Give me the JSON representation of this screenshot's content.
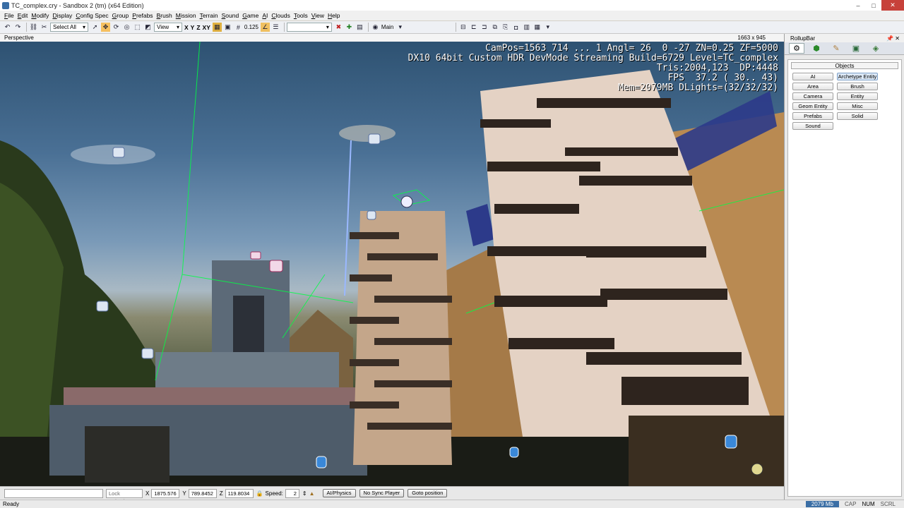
{
  "window": {
    "title": "TC_complex.cry - Sandbox 2 (tm) (x64 Edition)",
    "controls": [
      "–",
      "□",
      "✕"
    ]
  },
  "menu": [
    "File",
    "Edit",
    "Modify",
    "Display",
    "Config Spec",
    "Group",
    "Prefabs",
    "Brush",
    "Mission",
    "Terrain",
    "Sound",
    "Game",
    "AI",
    "Clouds",
    "Tools",
    "View",
    "Help"
  ],
  "toolbar": {
    "select_mode": "Select All",
    "view_combo": "View",
    "axes": [
      "X",
      "Y",
      "Z",
      "XY"
    ],
    "snap_value": "0.125",
    "layer_combo": "",
    "main_label": "Main"
  },
  "viewport": {
    "label": "Perspective",
    "resolution": "1663 x 945",
    "hud_lines": [
      "CamPos=1563 714 ... 1 Angl= 26  0 -27 ZN=0.25 ZF=5000",
      "DX10 64bit Custom HDR DevMode Streaming Build=6729 Level=TC_complex",
      "Tris:2004,123  DP:4448",
      "FPS  37.2 ( 30.. 43)",
      "Mem=2079MB DLights=(32/32/32)"
    ]
  },
  "rollup": {
    "title": "RollupBar",
    "pin": "📌",
    "close": "✕",
    "section_header": "Objects",
    "buttons": [
      {
        "label": "AI",
        "selected": false
      },
      {
        "label": "Archetype Entity",
        "selected": true
      },
      {
        "label": "Area",
        "selected": false
      },
      {
        "label": "Brush",
        "selected": false
      },
      {
        "label": "Camera",
        "selected": false
      },
      {
        "label": "Entity",
        "selected": false
      },
      {
        "label": "Geom Entity",
        "selected": false
      },
      {
        "label": "Misc",
        "selected": false
      },
      {
        "label": "Prefabs",
        "selected": false
      },
      {
        "label": "Solid",
        "selected": false
      },
      {
        "label": "Sound",
        "selected": false
      }
    ]
  },
  "bottom": {
    "lock_selection": "Lock Selection",
    "x_label": "X",
    "x_value": "1875.576",
    "y_label": "Y",
    "y_value": "789.8452",
    "z_label": "Z",
    "z_value": "119.8034",
    "speed_label": "Speed:",
    "speed_value": "2",
    "ai_physics": "AI/Physics",
    "no_sync": "No Sync Player",
    "goto": "Goto position"
  },
  "status": {
    "left": "Ready",
    "memory": "2079 Mb",
    "caps": "CAP",
    "num": "NUM",
    "scrl": "SCRL"
  },
  "colors": {
    "accent": "#3a6ea5",
    "selection": "#00ff44"
  }
}
